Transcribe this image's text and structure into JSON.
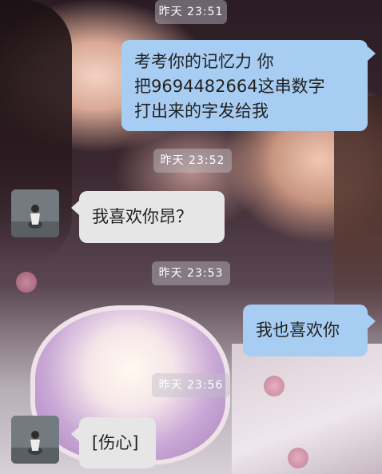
{
  "chat": {
    "messages": [
      {
        "kind": "time",
        "text": "昨天 23:51"
      },
      {
        "kind": "out",
        "lines": [
          "考考你的记忆力  你",
          "把9694482664这串数字",
          "打出来的字发给我"
        ]
      },
      {
        "kind": "time",
        "text": "昨天 23:52"
      },
      {
        "kind": "in",
        "text": "我喜欢你昂？"
      },
      {
        "kind": "time",
        "text": "昨天 23:53"
      },
      {
        "kind": "out",
        "text": "我也喜欢你"
      },
      {
        "kind": "time",
        "text": "昨天 23:56"
      },
      {
        "kind": "in",
        "text": "[伤心]"
      }
    ]
  },
  "colors": {
    "outgoing_bubble": "#a8cdf2",
    "incoming_bubble": "#e6e6e6",
    "timestamp_pill": "#bebec8"
  },
  "icons": {
    "avatar": "contact-avatar"
  }
}
